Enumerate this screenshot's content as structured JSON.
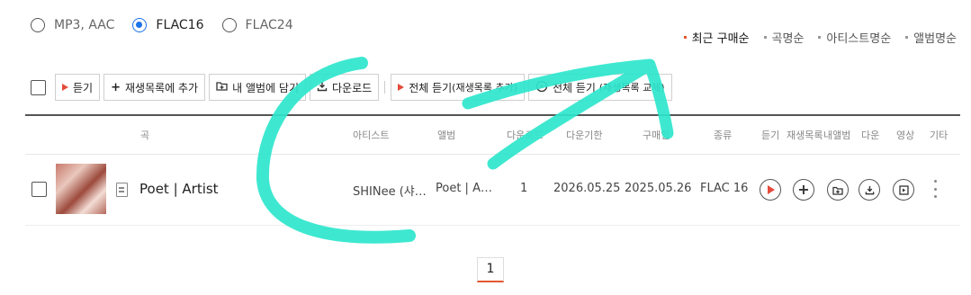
{
  "formats": [
    {
      "label": "MP3, AAC",
      "selected": false
    },
    {
      "label": "FLAC16",
      "selected": true
    },
    {
      "label": "FLAC24",
      "selected": false
    }
  ],
  "sort": [
    {
      "label": "최근 구매순",
      "active": true
    },
    {
      "label": "곡명순",
      "active": false
    },
    {
      "label": "아티스트명순",
      "active": false
    },
    {
      "label": "앨범명순",
      "active": false
    }
  ],
  "toolbar": {
    "listen": "듣기",
    "add_playlist": "재생목록에 추가",
    "add_album_a": "내 앨범에",
    "add_album_b": "담기",
    "download": "다운로드",
    "play_all_a": "전체 듣기",
    "play_all_b": "(재생목록 추가)",
    "play_all_replace_a": "전체 듣기",
    "play_all_replace_b": "(재생목록 교체)"
  },
  "columns": {
    "song": "곡",
    "artist": "아티스트",
    "album": "앨범",
    "download_count": "다운로드",
    "download_deadline": "다운기한",
    "purchase_date": "구매일",
    "type": "종류",
    "listen": "듣기",
    "playlist": "재생목록",
    "my_album": "내앨범",
    "download": "다운",
    "video": "영상",
    "more": "기타"
  },
  "rows": [
    {
      "title": "Poet | Artist",
      "artist": "SHINee (샤…",
      "album": "Poet | A…",
      "download_count": "1",
      "download_deadline": "2026.05.25",
      "purchase_date": "2025.05.26",
      "type": "FLAC 16"
    }
  ],
  "pagination": {
    "current": "1"
  },
  "accent_colors": {
    "radio": "#1a73e8",
    "play": "#e54b3c",
    "scribble": "#2ee6cc"
  },
  "icons": [
    "play-icon",
    "plus-icon",
    "add-folder-icon",
    "download-icon",
    "video-icon",
    "more-icon",
    "document-icon",
    "circular-play-icon"
  ]
}
